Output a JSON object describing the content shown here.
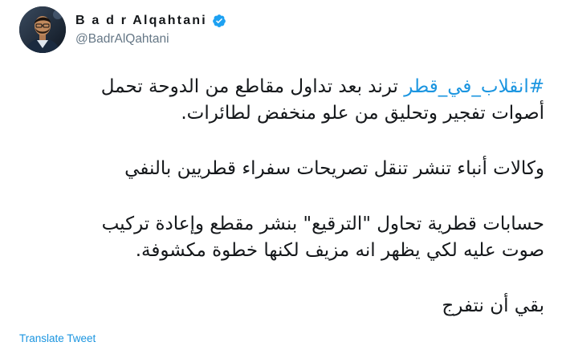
{
  "user": {
    "display_name": "B a d r Alqahtani",
    "handle": "@BadrAlQahtani",
    "verified": true,
    "verified_color": "#1da1f2"
  },
  "tweet": {
    "line1_hashtag": "#انقلاب_في_قطر",
    "line1_text": " ترند بعد تداول مقاطع من الدوحة تحمل",
    "line2": "أصوات تفجير وتحليق من علو منخفض لطائرات.",
    "line3": "وكالات أنباء تنشر تنقل تصريحات سفراء قطريين بالنفي",
    "line4": "حسابات قطرية تحاول \"الترقيع\" بنشر مقطع وإعادة تركيب",
    "line5": "صوت عليه لكي يظهر انه مزيف لكنها خطوة مكشوفة.",
    "line6": "بقي أن نتفرج"
  },
  "actions": {
    "translate_label": "Translate Tweet"
  },
  "colors": {
    "link": "#1b95e0",
    "text": "#14171a",
    "muted": "#657786"
  }
}
